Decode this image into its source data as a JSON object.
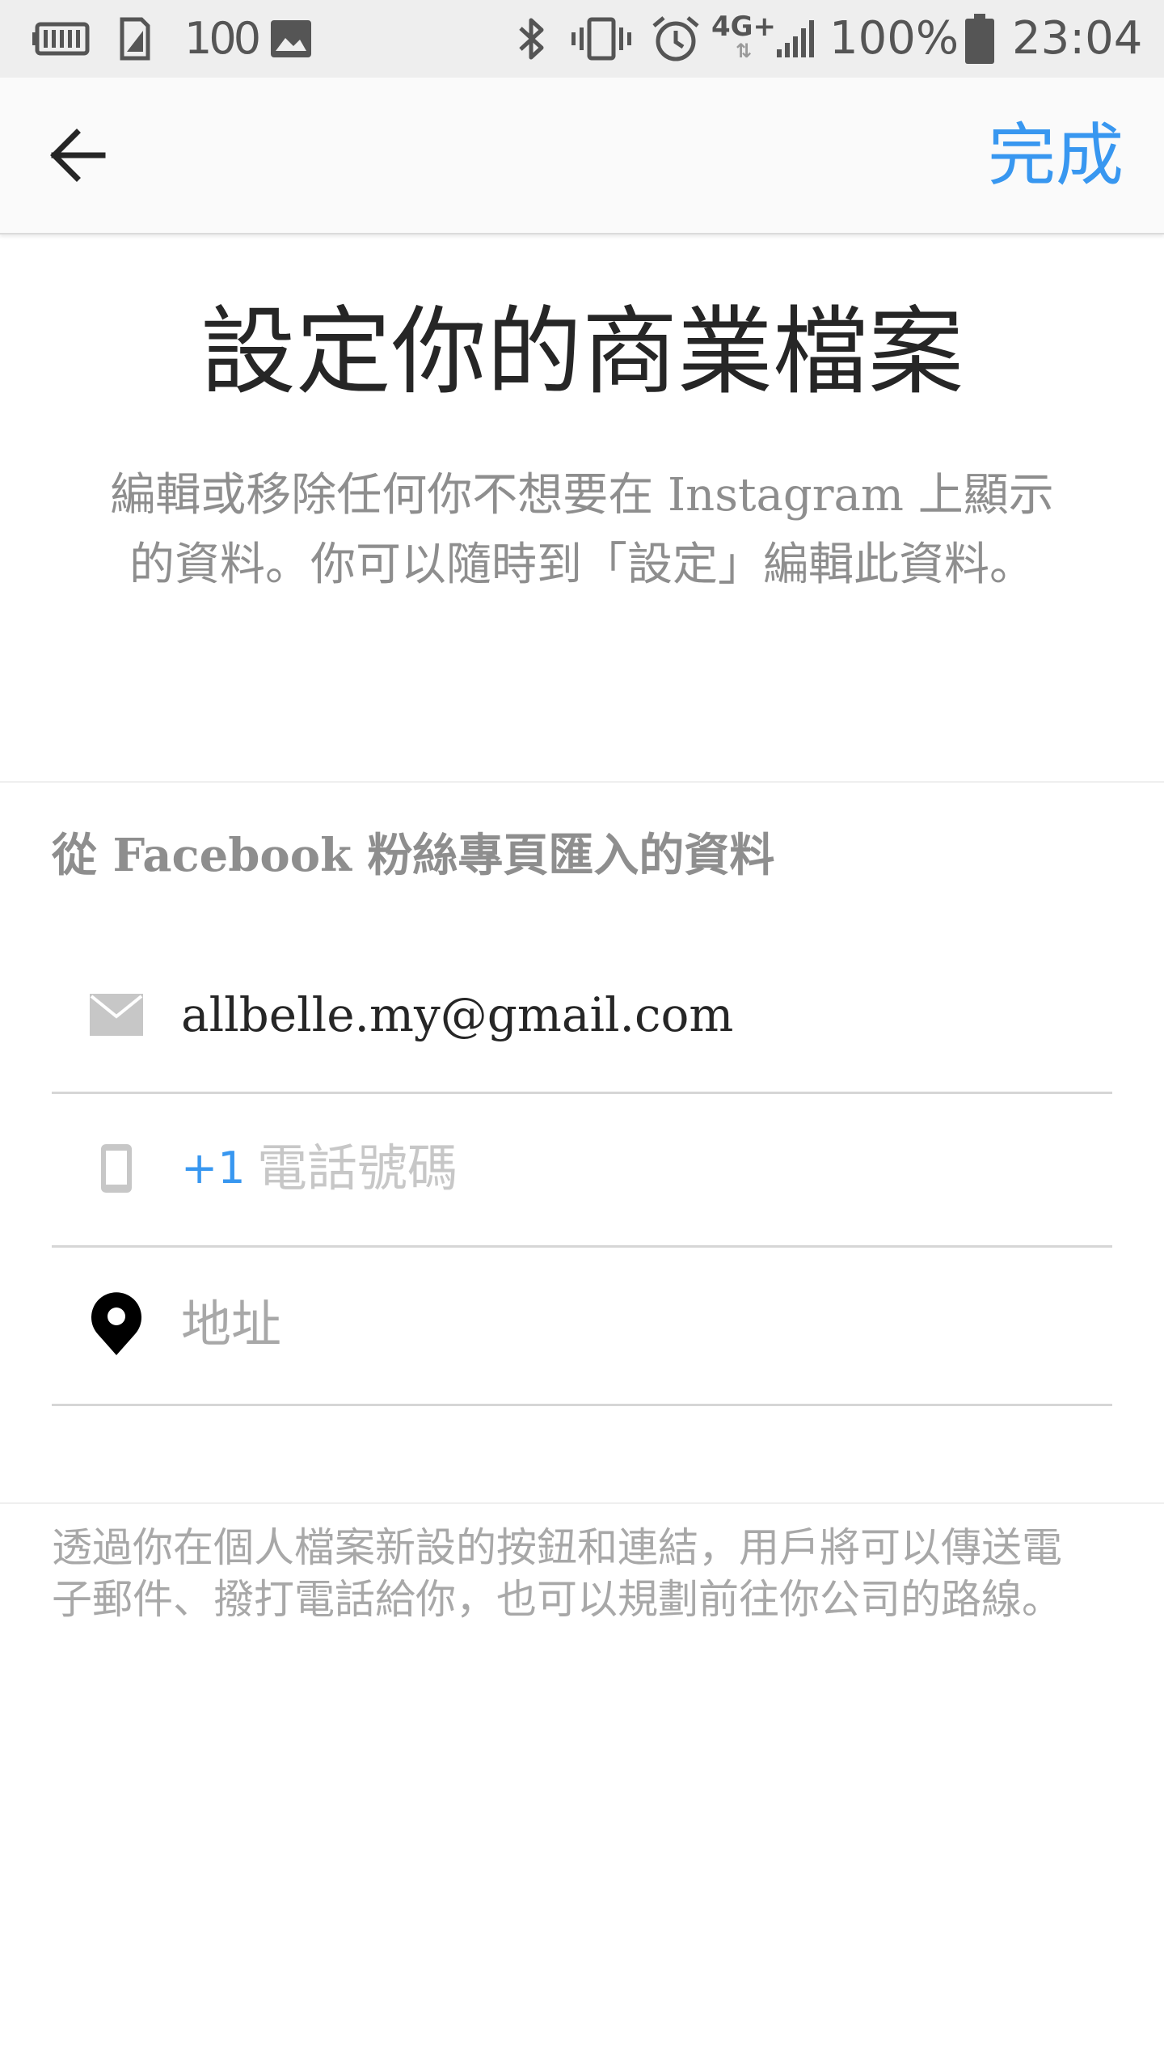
{
  "status_bar": {
    "icons": [
      "battery-saver-icon",
      "sim-card-icon",
      "notification-100-icon",
      "image-icon",
      "bluetooth-icon",
      "vibrate-icon",
      "alarm-icon",
      "4g-lte-icon",
      "signal-icon",
      "battery-icon"
    ],
    "notification_count": "100",
    "network_type": "4G+",
    "battery_percent": "100%",
    "time": "23:04"
  },
  "toolbar": {
    "back_icon": "arrow-left-icon",
    "done_label": "完成"
  },
  "header": {
    "title": "設定你的商業檔案",
    "subtitle": "編輯或移除任何你不想要在 Instagram 上顯示的資料。你可以隨時到「設定」編輯此資料。"
  },
  "section": {
    "title": "從 Facebook 粉絲專頁匯入的資料"
  },
  "fields": {
    "email": {
      "icon": "envelope-icon",
      "value": "allbelle.my@gmail.com"
    },
    "phone": {
      "icon": "mobile-phone-icon",
      "country_code": "+1",
      "placeholder": "電話號碼"
    },
    "address": {
      "icon": "location-pin-icon",
      "placeholder": "地址"
    }
  },
  "footer": {
    "note": "透過你在個人檔案新設的按鈕和連結，用戶將可以傳送電子郵件、撥打電話給你，也可以規劃前往你公司的路線。"
  },
  "colors": {
    "accent": "#3897f0",
    "text_primary": "#262626",
    "text_secondary": "#8e8e8e",
    "placeholder": "#c7c7c7",
    "status_bar_bg": "#eeeeee",
    "toolbar_bg": "#fafafa"
  }
}
